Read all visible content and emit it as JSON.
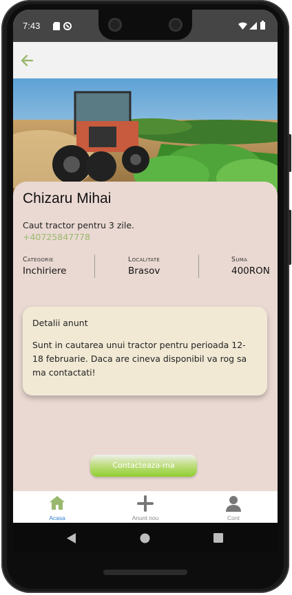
{
  "status_bar": {
    "time": "7:43"
  },
  "colors": {
    "accent": "#9ab86e",
    "nav_active": "#2d7dd2",
    "card_bg": "#ead9d2",
    "details_bg": "#f1e9d4"
  },
  "listing": {
    "name": "Chizaru Mihai",
    "short_description": "Caut tractor pentru 3 zile.",
    "phone": "+40725847778",
    "info": [
      {
        "label": "Categorie",
        "value": "Inchiriere"
      },
      {
        "label": "Localitate",
        "value": "Brasov"
      },
      {
        "label": "Suma",
        "value": "400RON"
      }
    ],
    "details_title": "Detalii anunt",
    "details_text": "Sunt in cautarea unui tractor pentru perioada 12-18 februarie. Daca are cineva disponibil va rog sa ma contactati!",
    "contact_label": "Contacteaza-ma"
  },
  "bottom_nav": [
    {
      "label": "Acasa",
      "icon": "home-icon",
      "active": true
    },
    {
      "label": "Anunt nou",
      "icon": "plus-icon",
      "active": false
    },
    {
      "label": "Cont",
      "icon": "user-icon",
      "active": false
    }
  ],
  "icons": {
    "back": "arrow-left-icon",
    "hero": "tractor-field-photo"
  }
}
